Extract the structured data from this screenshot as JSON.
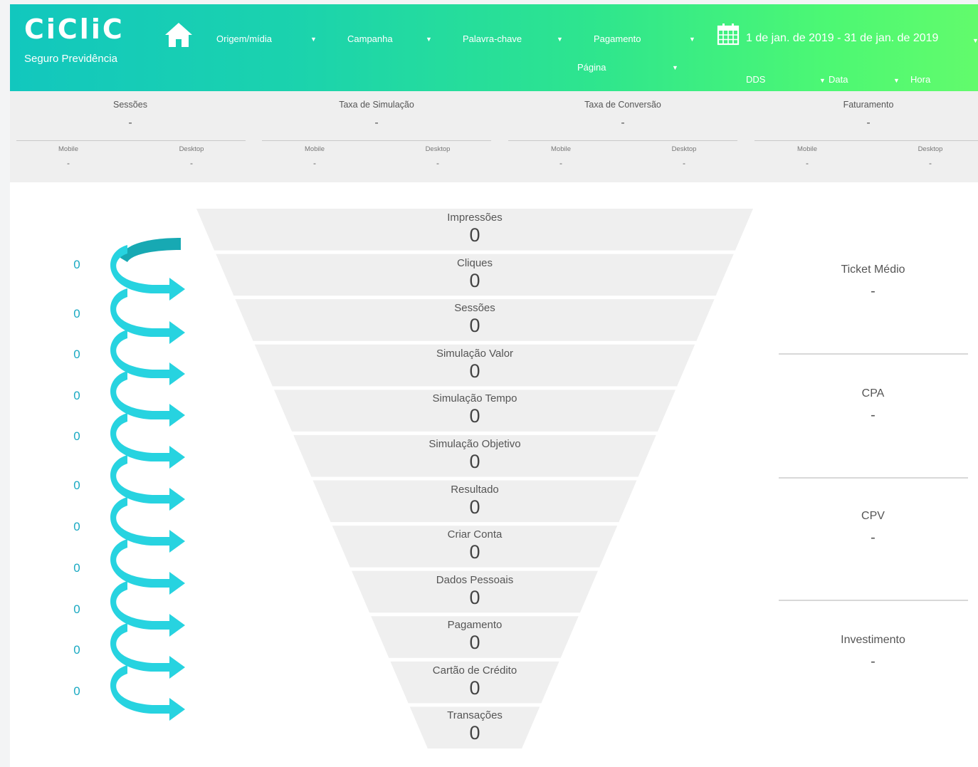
{
  "header": {
    "logo": "CiCliC",
    "subtitle": "Seguro Previdência",
    "filters": {
      "origem": "Origem/mídia",
      "campanha": "Campanha",
      "palavra": "Palavra-chave",
      "pagamento": "Pagamento",
      "pagina": "Página",
      "dds": "DDS",
      "data": "Data",
      "hora": "Hora"
    },
    "date_range": "1 de jan. de 2019 - 31 de jan. de 2019"
  },
  "kpis": [
    {
      "title": "Sessões",
      "value": "-",
      "mobile_label": "Mobile",
      "mobile_value": "-",
      "desktop_label": "Desktop",
      "desktop_value": "-"
    },
    {
      "title": "Taxa de Simulação",
      "value": "-",
      "mobile_label": "Mobile",
      "mobile_value": "-",
      "desktop_label": "Desktop",
      "desktop_value": "-"
    },
    {
      "title": "Taxa de Conversão",
      "value": "-",
      "mobile_label": "Mobile",
      "mobile_value": "-",
      "desktop_label": "Desktop",
      "desktop_value": "-"
    },
    {
      "title": "Faturamento",
      "value": "-",
      "mobile_label": "Mobile",
      "mobile_value": "-",
      "desktop_label": "Desktop",
      "desktop_value": "-"
    }
  ],
  "funnel": {
    "stages": [
      {
        "label": "Impressões",
        "value": "0"
      },
      {
        "label": "Cliques",
        "value": "0"
      },
      {
        "label": "Sessões",
        "value": "0"
      },
      {
        "label": "Simulação Valor",
        "value": "0"
      },
      {
        "label": "Simulação Tempo",
        "value": "0"
      },
      {
        "label": "Simulação Objetivo",
        "value": "0"
      },
      {
        "label": "Resultado",
        "value": "0"
      },
      {
        "label": "Criar Conta",
        "value": "0"
      },
      {
        "label": "Dados Pessoais",
        "value": "0"
      },
      {
        "label": "Pagamento",
        "value": "0"
      },
      {
        "label": "Cartão de Crédito",
        "value": "0"
      },
      {
        "label": "Transações",
        "value": "0"
      }
    ],
    "conversion_rates": [
      "0",
      "0",
      "0",
      "0",
      "0",
      "0",
      "0",
      "0",
      "0",
      "0",
      "0"
    ]
  },
  "metrics": [
    {
      "label": "Ticket Médio",
      "value": "-"
    },
    {
      "label": "CPA",
      "value": "-"
    },
    {
      "label": "CPV",
      "value": "-"
    },
    {
      "label": "Investimento",
      "value": "-"
    }
  ],
  "colors": {
    "header_gradient_start": "#12c7be",
    "header_gradient_end": "#62fb6c",
    "arrow": "#27d3e0",
    "arrow_dark": "#17a9b3",
    "rate_text": "#19a9c2",
    "funnel_fill": "#efefef"
  }
}
